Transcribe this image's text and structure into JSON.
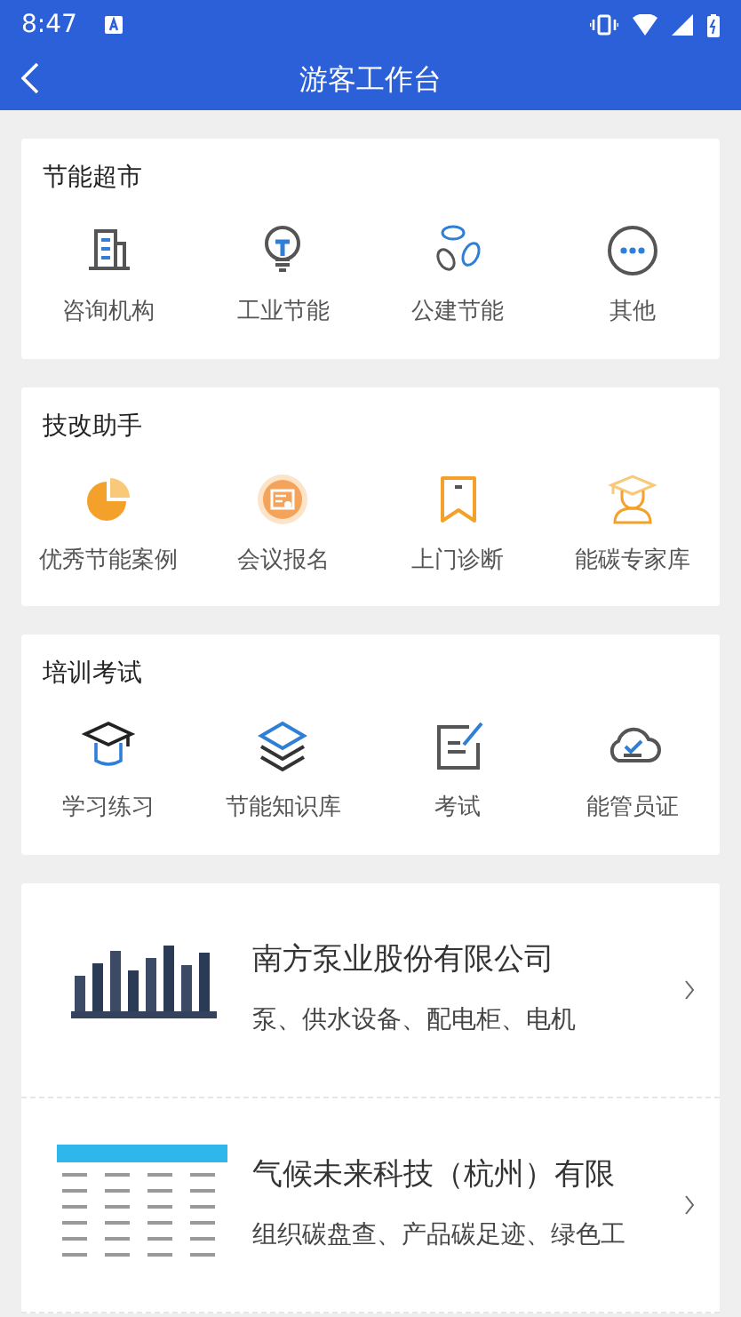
{
  "status_bar": {
    "time": "8:47"
  },
  "header": {
    "title": "游客工作台"
  },
  "sections": [
    {
      "title": "节能超市",
      "items": [
        {
          "label": "咨询机构"
        },
        {
          "label": "工业节能"
        },
        {
          "label": "公建节能"
        },
        {
          "label": "其他"
        }
      ]
    },
    {
      "title": "技改助手",
      "items": [
        {
          "label": "优秀节能案例"
        },
        {
          "label": "会议报名"
        },
        {
          "label": "上门诊断"
        },
        {
          "label": "能碳专家库"
        }
      ]
    },
    {
      "title": "培训考试",
      "items": [
        {
          "label": "学习练习"
        },
        {
          "label": "节能知识库"
        },
        {
          "label": "考试"
        },
        {
          "label": "能管员证"
        }
      ]
    }
  ],
  "companies": [
    {
      "name": "南方泵业股份有限公司",
      "products": "泵、供水设备、配电柜、电机"
    },
    {
      "name": "气候未来科技（杭州）有限",
      "products": "组织碳盘查、产品碳足迹、绿色工"
    }
  ]
}
